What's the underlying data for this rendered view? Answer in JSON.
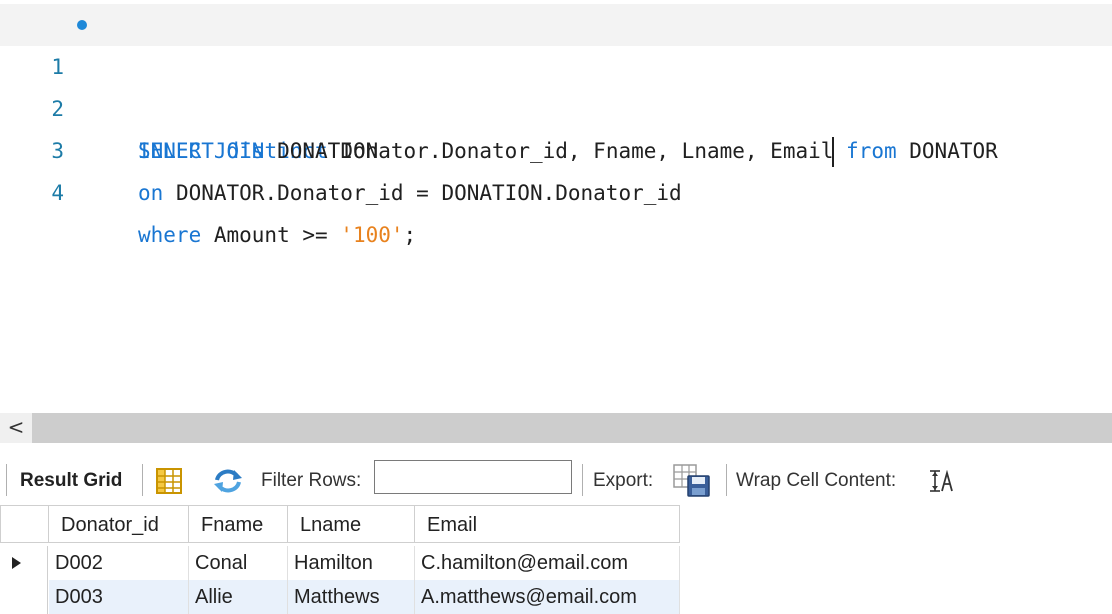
{
  "editor": {
    "lines": [
      {
        "num": "1",
        "has_marker": true
      },
      {
        "num": "2"
      },
      {
        "num": "3"
      },
      {
        "num": "4"
      }
    ],
    "tokens": {
      "l1_select": "SELECT",
      "l1_distinct": "distinct",
      "l1_cols": " Donator.Donator_id, Fname, Lname, Email",
      "l1_from": " from",
      "l1_table": " DONATOR",
      "l2_inner": "INNER",
      "l2_join": " JOIN",
      "l2_table": " DONATION",
      "l3_on": "on",
      "l3_cond": " DONATOR.Donator_id = DONATION.Donator_id",
      "l4_where": "where",
      "l4_cond": " Amount >= ",
      "l4_val": "'100'",
      "l4_end": ";"
    },
    "colors": {
      "keyword": "#1976d2",
      "string": "#e8821e",
      "line_number": "#1c7ba7"
    }
  },
  "scrollbar": {
    "left_arrow": "<"
  },
  "toolbar": {
    "result_grid_label": "Result Grid",
    "filter_rows_label": "Filter Rows:",
    "filter_value": "",
    "export_label": "Export:",
    "wrap_label": "Wrap Cell Content:"
  },
  "grid": {
    "columns": [
      "Donator_id",
      "Fname",
      "Lname",
      "Email"
    ],
    "rows": [
      [
        "D002",
        "Conal",
        "Hamilton",
        "C.hamilton@email.com"
      ],
      [
        "D003",
        "Allie",
        "Matthews",
        "A.matthews@email.com"
      ]
    ]
  }
}
